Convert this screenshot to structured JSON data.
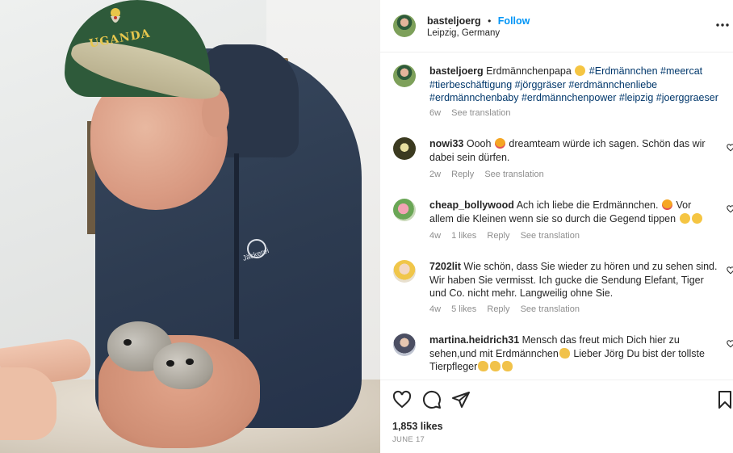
{
  "header": {
    "username": "basteljoerg",
    "separator": "•",
    "follow_label": "Follow",
    "location": "Leipzig, Germany",
    "more_label": "..."
  },
  "photo": {
    "cap_text": "UGANDA",
    "jacket_logo_text": "Jäckerei"
  },
  "caption": {
    "username": "basteljoerg",
    "text": "Erdmännchenpapa",
    "hashtags_line1": "#Erdmännchen #meercat",
    "hashtags_line2": "#tierbeschäftigung #jörggräser #erdmännchenliebe",
    "hashtags_line3": "#erdmännchenbaby #erdmännchenpower #leipzig #joerggraeser",
    "time": "6w",
    "see_translation": "See translation"
  },
  "comments": [
    {
      "username": "nowi33",
      "line1_pre": "Oooh",
      "line1_post": "dreamteam würde ich sagen. Schön das wir",
      "line2": "dabei sein dürfen.",
      "time": "2w",
      "likes": "",
      "reply": "Reply",
      "see_translation": "See translation"
    },
    {
      "username": "cheap_bollywood",
      "line1_pre": "Ach ich liebe die Erdmännchen.",
      "line1_post": "Vor",
      "line2": "allem die Kleinen wenn sie so durch die Gegend tippen",
      "time": "4w",
      "likes": "1 likes",
      "reply": "Reply",
      "see_translation": "See translation"
    },
    {
      "username": "7202lit",
      "line1": "Wie schön, dass Sie wieder zu hören und zu sehen sind.",
      "line2": "Wir haben Sie vermisst. Ich gucke die Sendung Elefant, Tiger",
      "line3": "und Co. nicht mehr. Langweilig ohne Sie.",
      "time": "4w",
      "likes": "5 likes",
      "reply": "Reply",
      "see_translation": "See translation"
    },
    {
      "username": "martina.heidrich31",
      "line1": "Mensch das freut mich Dich hier zu",
      "line2_pre": "sehen,und mit Erdmännchen",
      "line2_post": "Lieber Jörg Du bist der tollste",
      "line3": "Tierpfleger"
    }
  ],
  "footer": {
    "likes": "1,853 likes",
    "date": "JUNE 17"
  },
  "icons": {
    "like": "heart-icon",
    "comment": "comment-icon",
    "share": "share-icon",
    "save": "bookmark-icon",
    "more": "more-icon"
  }
}
